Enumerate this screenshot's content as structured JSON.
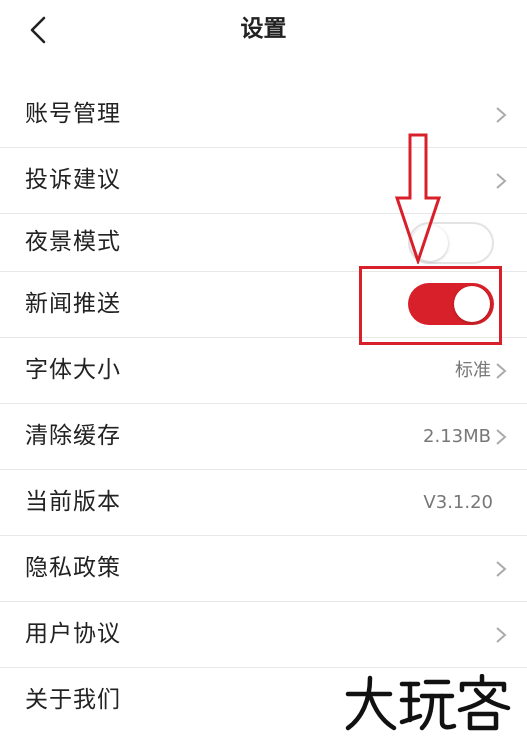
{
  "header": {
    "title": "设置"
  },
  "rows": [
    {
      "label": "账号管理"
    },
    {
      "label": "投诉建议"
    },
    {
      "label": "夜景模式",
      "toggle": "off"
    },
    {
      "label": "新闻推送",
      "toggle": "on"
    },
    {
      "label": "字体大小",
      "value": "标准"
    },
    {
      "label": "清除缓存",
      "value": "2.13MB"
    },
    {
      "label": "当前版本",
      "value": "V3.1.20"
    },
    {
      "label": "隐私政策"
    },
    {
      "label": "用户协议"
    },
    {
      "label": "关于我们"
    }
  ],
  "colors": {
    "accent": "#d8202a",
    "toggle_off_border": "#e3e3e3",
    "divider": "#e8e8e8"
  },
  "watermark": {
    "text": "大玩客"
  },
  "icons": {
    "back": "chevron-left-icon",
    "row": "chevron-right-icon",
    "annotation": "down-arrow-icon"
  }
}
